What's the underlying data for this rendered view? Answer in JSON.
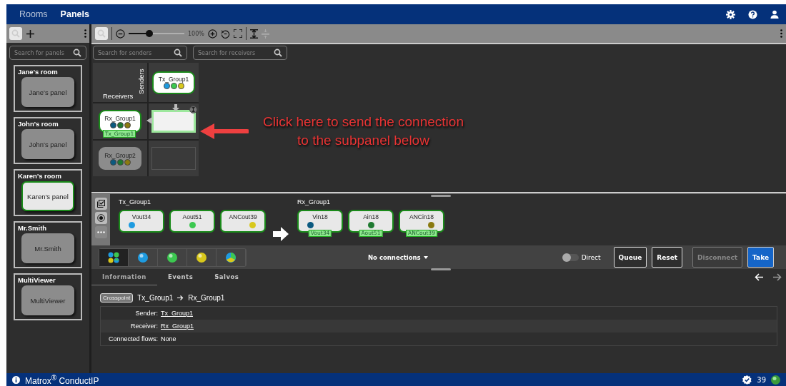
{
  "nav": {
    "items": [
      {
        "label": "Rooms",
        "selected": false
      },
      {
        "label": "Panels",
        "selected": true
      }
    ]
  },
  "sidebar": {
    "search": {
      "placeholder": "Search for panels"
    },
    "rooms": [
      {
        "title": "Jane's room",
        "panel": "Jane's panel",
        "selected": false
      },
      {
        "title": "John's room",
        "panel": "John's panel",
        "selected": false
      },
      {
        "title": "Karen's room",
        "panel": "Karen's panel",
        "selected": true
      },
      {
        "title": "Mr.Smith",
        "panel": "Mr.Smith",
        "selected": false
      },
      {
        "title": "MultiViewer",
        "panel": "MultiViewer",
        "selected": false
      }
    ]
  },
  "toolbar": {
    "zoom": {
      "level": 0.37,
      "reading": "100%"
    }
  },
  "matrix": {
    "sender_search": {
      "placeholder": "Search for senders"
    },
    "receiver_search": {
      "placeholder": "Search for receivers"
    },
    "senders_label": "Senders",
    "receivers_label": "Receivers",
    "senders": [
      {
        "name": "Tx_Group1",
        "selected": true,
        "dots": [
          {
            "color": "#1e9be0"
          },
          {
            "color": "#3cc850"
          },
          {
            "color": "#d8c81c"
          }
        ]
      }
    ],
    "receivers": [
      {
        "name": "Rx_Group1",
        "selected": true,
        "source": "Tx_Group1",
        "dots": [
          {
            "color": "#0b5a80"
          },
          {
            "color": "#1e7a30"
          },
          {
            "color": "#8a7a10"
          }
        ],
        "cell_selected": true
      },
      {
        "name": "Rx_Group2",
        "selected": false,
        "dots": [
          {
            "color": "#0b5a80"
          },
          {
            "color": "#1e7a30"
          },
          {
            "color": "#8a7a10"
          }
        ],
        "cell_selected": false
      }
    ],
    "callout": "Click here to send the connection\nto the subpanel below"
  },
  "connection": {
    "source": {
      "title": "Tx_Group1",
      "flows": [
        {
          "name": "Vout34",
          "color": "#1e9be0"
        },
        {
          "name": "Aout51",
          "color": "#3cc850"
        },
        {
          "name": "ANCout39",
          "color": "#d8c81c"
        }
      ]
    },
    "destination": {
      "title": "Rx_Group1",
      "flows": [
        {
          "name": "Vin18",
          "color": "#0b5a80",
          "tag": "Vout34"
        },
        {
          "name": "Ain18",
          "color": "#1e7a30",
          "tag": "Aout51"
        },
        {
          "name": "ANCin18",
          "color": "#8a7a10",
          "tag": "ANCout39"
        }
      ]
    }
  },
  "filters": [
    {
      "kind": "all",
      "selected": true
    },
    {
      "kind": "video",
      "selected": false
    },
    {
      "kind": "audio",
      "selected": false
    },
    {
      "kind": "anc",
      "selected": false
    },
    {
      "kind": "mixed",
      "selected": false
    }
  ],
  "connections_menu": "No connections",
  "direct": {
    "label": "Direct",
    "on": false
  },
  "actions": [
    {
      "label": "Queue",
      "kind": "outline",
      "disabled": false
    },
    {
      "label": "Reset",
      "kind": "outline",
      "disabled": false
    },
    {
      "label": "Disconnect",
      "kind": "outline",
      "disabled": true
    },
    {
      "label": "Take",
      "kind": "primary",
      "disabled": false
    }
  ],
  "tabs": [
    {
      "label": "Information",
      "selected": true
    },
    {
      "label": "Events",
      "selected": false
    },
    {
      "label": "Salvos",
      "selected": false
    }
  ],
  "info": {
    "badge": "Crosspoint",
    "from": "Tx_Group1",
    "to": "Rx_Group1",
    "rows": [
      {
        "label": "Sender:",
        "value": "Tx_Group1",
        "kind": "link"
      },
      {
        "label": "Receiver:",
        "value": "Rx_Group1",
        "kind": "link"
      },
      {
        "label": "Connected flows:",
        "value": "None",
        "kind": "text"
      }
    ]
  },
  "footer": {
    "brand": "Matrox$^{®}$ ConductIP",
    "count": "39"
  }
}
